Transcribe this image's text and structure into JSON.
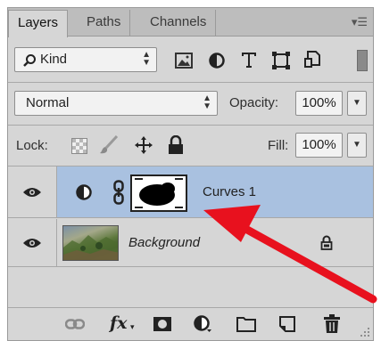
{
  "tabs": [
    {
      "label": "Layers",
      "active": true
    },
    {
      "label": "Paths",
      "active": false
    },
    {
      "label": "Channels",
      "active": false
    }
  ],
  "filter": {
    "label": "Kind",
    "icons": [
      "image-filter-icon",
      "adjustment-filter-icon",
      "type-filter-icon",
      "shape-filter-icon",
      "smart-object-filter-icon",
      "filter-toggle-icon"
    ]
  },
  "blend": {
    "mode": "Normal",
    "opacity_label": "Opacity:",
    "opacity_value": "100%"
  },
  "lock": {
    "label": "Lock:",
    "fill_label": "Fill:",
    "fill_value": "100%"
  },
  "layers": [
    {
      "name": "Curves 1",
      "selected": true,
      "type": "adjustment"
    },
    {
      "name": "Background",
      "selected": false,
      "type": "image",
      "locked": true
    }
  ],
  "bottom_icons": [
    "link-layers-icon",
    "fx-icon",
    "add-mask-icon",
    "new-adjustment-icon",
    "new-group-icon",
    "new-layer-icon",
    "delete-icon"
  ],
  "colors": {
    "panel": "#d6d6d6",
    "selection": "#a9c1e0",
    "arrow": "#e8111e"
  },
  "fx_label": "fx"
}
